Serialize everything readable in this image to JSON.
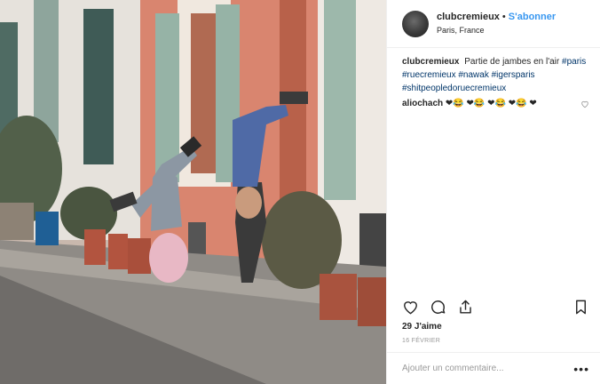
{
  "post": {
    "username": "clubcremieux",
    "separator": "•",
    "follow_label": "S'abonner",
    "location": "Paris, France",
    "caption": {
      "username": "clubcremieux",
      "text": "Partie de jambes en l'air",
      "hashtags": [
        "#paris",
        "#ruecremieux",
        "#nawak",
        "#igersparis",
        "#shitpeopledoruecremieux"
      ]
    },
    "comments": [
      {
        "username": "aliochach",
        "text": "❤😂 ❤😂 ❤😂 ❤😂 ❤"
      }
    ],
    "likes": "29 J'aime",
    "date": "16 FÉVRIER",
    "add_comment_placeholder": "Ajouter un commentaire...",
    "more_label": "•••"
  },
  "icons": [
    "heart-icon",
    "comment-icon",
    "share-icon",
    "bookmark-icon",
    "small-heart-icon"
  ],
  "colors": {
    "follow": "#3897f0",
    "hashtag": "#003569",
    "muted": "#999999",
    "border": "#efefef"
  }
}
